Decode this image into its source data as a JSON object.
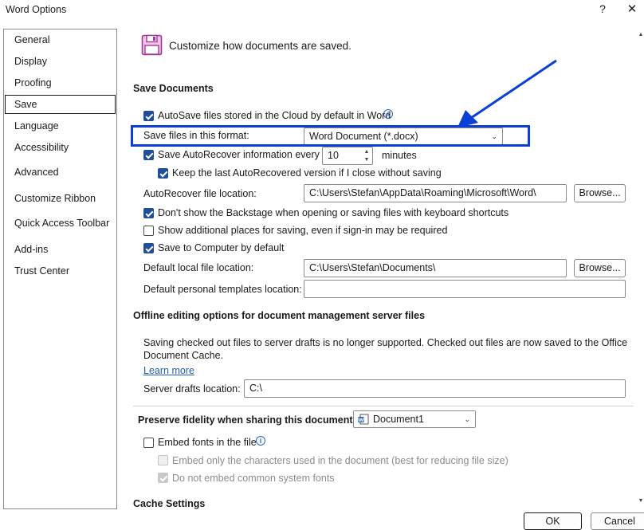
{
  "window": {
    "title": "Word Options",
    "help": "?",
    "close": "✕"
  },
  "sidebar": {
    "items": [
      {
        "label": "General"
      },
      {
        "label": "Display"
      },
      {
        "label": "Proofing"
      },
      {
        "label": "Save",
        "selected": true
      },
      {
        "label": "Language"
      },
      {
        "label": "Accessibility"
      },
      {
        "label": "Advanced"
      },
      {
        "label": "Customize Ribbon"
      },
      {
        "label": "Quick Access Toolbar"
      },
      {
        "label": "Add-ins"
      },
      {
        "label": "Trust Center"
      }
    ]
  },
  "page": {
    "heading": "Customize how documents are saved.",
    "icon": "save-floppy-icon"
  },
  "save_documents": {
    "section_title": "Save Documents",
    "autosave_label": "AutoSave files stored in the Cloud by default in Word",
    "autosave_checked": true,
    "format_label": "Save files in this format:",
    "format_value": "Word Document (*.docx)",
    "autorecover_label": "Save AutoRecover information every",
    "autorecover_checked": true,
    "autorecover_minutes": "10",
    "minutes_label": "minutes",
    "keep_last_label": "Keep the last AutoRecovered version if I close without saving",
    "keep_last_checked": true,
    "autorecover_location_label": "AutoRecover file location:",
    "autorecover_location_value": "C:\\Users\\Stefan\\AppData\\Roaming\\Microsoft\\Word\\",
    "browse_label": "Browse...",
    "backstage_label": "Don't show the Backstage when opening or saving files with keyboard shortcuts",
    "backstage_checked": true,
    "additional_places_label": "Show additional places for saving, even if sign-in may be required",
    "additional_places_checked": false,
    "save_to_computer_label": "Save to Computer by default",
    "save_to_computer_checked": true,
    "default_local_label": "Default local file location:",
    "default_local_value": "C:\\Users\\Stefan\\Documents\\",
    "default_templates_label": "Default personal templates location:",
    "default_templates_value": ""
  },
  "offline": {
    "section_title": "Offline editing options for document management server files",
    "message_line1": "Saving checked out files to server drafts is no longer supported. Checked out files are now saved to the Office",
    "message_line2": "Document Cache.",
    "learn_more": "Learn more",
    "server_drafts_label": "Server drafts location:",
    "server_drafts_value": "C:\\"
  },
  "fidelity": {
    "section_title": "Preserve fidelity when sharing this document:",
    "document_value": "Document1",
    "embed_fonts_label": "Embed fonts in the file",
    "embed_fonts_checked": false,
    "embed_only_label": "Embed only the characters used in the document (best for reducing file size)",
    "embed_only_checked": false,
    "no_common_label": "Do not embed common system fonts",
    "no_common_checked": true
  },
  "cache": {
    "section_title": "Cache Settings"
  },
  "footer": {
    "ok": "OK",
    "cancel": "Cancel"
  },
  "colors": {
    "highlight": "#0b3fd6",
    "accent": "#1f4e9c",
    "link": "#1f5fb8"
  }
}
